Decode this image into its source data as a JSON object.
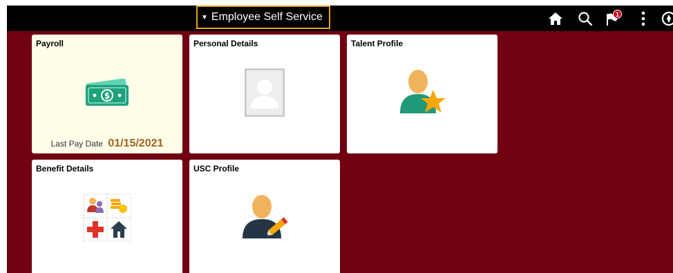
{
  "header": {
    "homepage_selector": "Employee Self Service",
    "notification_count": "1",
    "icons": [
      "home-icon",
      "search-icon",
      "notification-flag-icon",
      "actions-menu-icon",
      "navbar-icon"
    ]
  },
  "tiles": {
    "payroll": {
      "title": "Payroll",
      "icon": "money-icon",
      "last_pay_label": "Last Pay Date",
      "last_pay_date": "01/15/2021"
    },
    "personal_details": {
      "title": "Personal Details",
      "icon": "person-placeholder-icon"
    },
    "talent_profile": {
      "title": "Talent Profile",
      "icon": "person-star-icon"
    },
    "benefit_details": {
      "title": "Benefit Details",
      "icon": "benefits-grid-icon"
    },
    "usc_profile": {
      "title": "USC Profile",
      "icon": "person-edit-icon"
    }
  },
  "colors": {
    "background": "#710011",
    "topbar": "#000000",
    "selector_border": "#e8a317",
    "payroll_tile": "#fffde8",
    "pay_date": "#a0631d",
    "badge": "#d0021b"
  }
}
